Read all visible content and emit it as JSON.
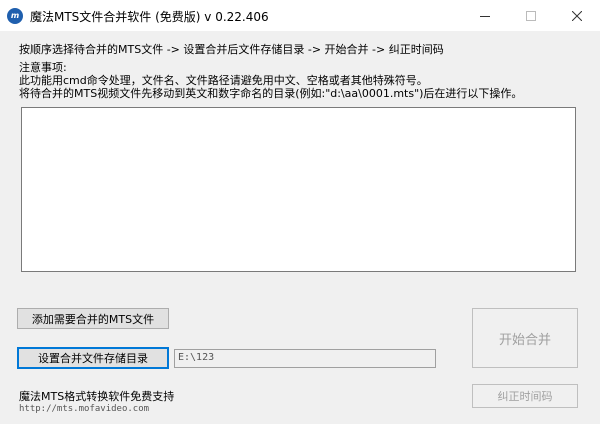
{
  "window": {
    "title": "魔法MTS文件合并软件 (免费版) v 0.22.406",
    "icon": "mts-app-icon"
  },
  "instructions": {
    "steps": "按顺序选择待合并的MTS文件 -> 设置合并后文件存储目录  -> 开始合并 -> 纠正时间码",
    "notice_title": "注意事项:",
    "notice_1": "此功能用cmd命令处理，文件名、文件路径请避免用中文、空格或者其他特殊符号。",
    "notice_2": "将待合并的MTS视频文件先移动到英文和数字命名的目录(例如:\"d:\\aa\\0001.mts\")后在进行以下操作。"
  },
  "file_list": {
    "items": []
  },
  "buttons": {
    "add_files": "添加需要合并的MTS文件",
    "set_output": "设置合并文件存储目录",
    "start_merge": "开始合并",
    "fix_timecode": "纠正时间码"
  },
  "output_path": {
    "value": "E:\\123"
  },
  "footer": {
    "support": "魔法MTS格式转换软件免费支持",
    "url": "http://mts.mofavideo.com"
  }
}
